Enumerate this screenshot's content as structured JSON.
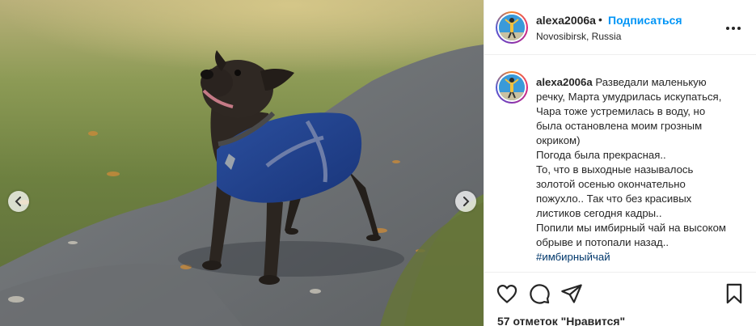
{
  "post": {
    "username": "alexa2006a",
    "separator": "•",
    "follow_label": "Подписаться",
    "location": "Novosibirsk, Russia",
    "more_icon": "more-options-icon"
  },
  "caption": {
    "username": "alexa2006a",
    "lines": [
      "Разведали маленькую",
      "речку, Марта умудрилась искупаться,",
      "Чара тоже устремилась в воду, но",
      "была остановлена моим грозным",
      "окриком)",
      "Погода была прекрасная..",
      "То, что в выходные называлось",
      "золотой осенью окончательно",
      "пожухло.. Так что без красивых",
      "листиков сегодня кадры..",
      "Попили мы имбирный чай на высоком",
      "обрыве и потопали назад.."
    ],
    "hashtag": "#имбирныйчай"
  },
  "actions": {
    "icons": [
      "heart-icon",
      "comment-icon",
      "share-icon",
      "bookmark-icon"
    ]
  },
  "likes_text": "57 отметок \"Нравится\"",
  "carousel": {
    "prev_icon": "chevron-left-icon",
    "next_icon": "chevron-right-icon"
  },
  "colors": {
    "follow": "#0095f6",
    "hashtag": "#00376b",
    "text": "#262626",
    "coat": "#1f3f86"
  }
}
